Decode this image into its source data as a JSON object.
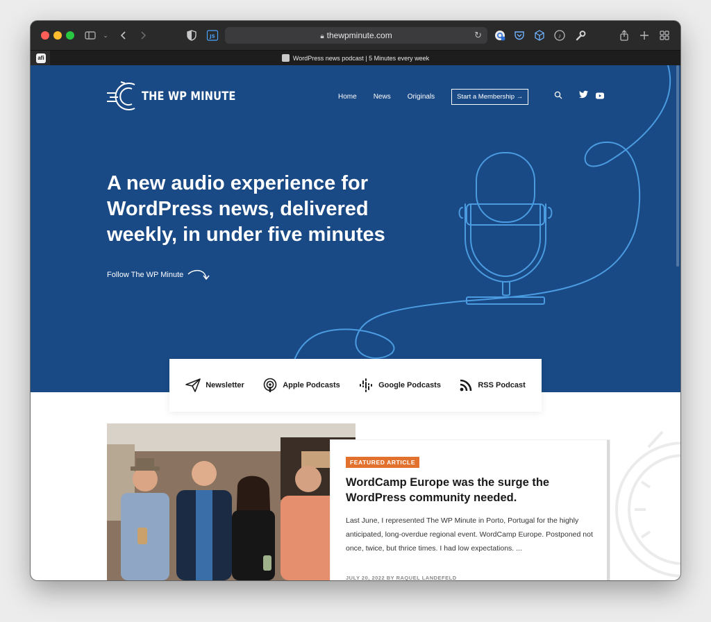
{
  "browser": {
    "url": "thewpminute.com",
    "tab_title": "WordPress news podcast | 5 Minutes every week",
    "extension_js_label": "JS",
    "tab_badge": "afi"
  },
  "site": {
    "logo_text": "THE WP MINUTE",
    "nav": {
      "home": "Home",
      "news": "News",
      "originals": "Originals",
      "cta": "Start a Membership →"
    },
    "hero": {
      "headline": "A new audio experience for WordPress news, delivered weekly, in under five minutes",
      "follow": "Follow The WP Minute"
    },
    "subscribe": [
      {
        "label": "Newsletter",
        "icon": "paper-plane-icon"
      },
      {
        "label": "Apple Podcasts",
        "icon": "podcast-icon"
      },
      {
        "label": "Google Podcasts",
        "icon": "google-podcasts-icon"
      },
      {
        "label": "RSS Podcast",
        "icon": "rss-icon"
      }
    ],
    "featured": {
      "badge": "FEATURED ARTICLE",
      "title": "WordCamp Europe was the surge the WordPress community needed.",
      "excerpt": "Last June, I represented The WP Minute in Porto, Portugal for the highly anticipated, long-overdue regional event. WordCamp Europe. Postponed not once, twice, but thrice times. I had low expectations. ...",
      "meta": "JULY 20, 2022 BY RAQUEL LANDEFELD"
    }
  },
  "colors": {
    "hero_bg": "#1a4a86",
    "accent_line": "#4a9be0",
    "badge": "#e2712d"
  }
}
